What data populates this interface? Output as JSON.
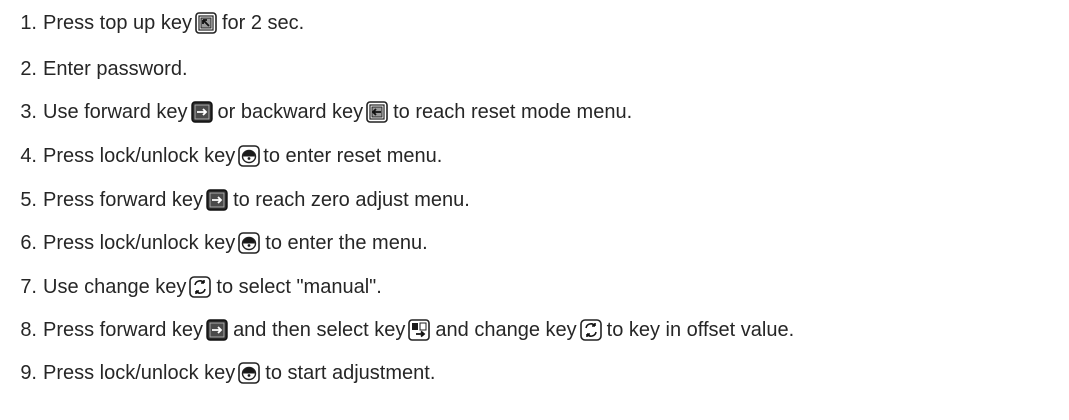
{
  "steps": [
    {
      "number": "1.",
      "parts": [
        {
          "type": "text",
          "value": "Press top up key"
        },
        {
          "type": "icon",
          "icon": "top-up-key-icon"
        },
        {
          "type": "text",
          "value": "for 2 sec."
        }
      ]
    },
    {
      "number": "2.",
      "parts": [
        {
          "type": "text",
          "value": "Enter password."
        }
      ]
    },
    {
      "number": "3.",
      "parts": [
        {
          "type": "text",
          "value": "Use forward key"
        },
        {
          "type": "icon",
          "icon": "forward-key-icon"
        },
        {
          "type": "text",
          "value": "or backward key"
        },
        {
          "type": "icon",
          "icon": "backward-key-icon"
        },
        {
          "type": "text",
          "value": "to reach reset mode menu."
        }
      ]
    },
    {
      "number": "4.",
      "parts": [
        {
          "type": "text",
          "value": "Press lock/unlock key"
        },
        {
          "type": "icon",
          "icon": "lock-unlock-key-icon"
        },
        {
          "type": "text",
          "value": "to enter reset menu.",
          "tight": true
        }
      ]
    },
    {
      "number": "5.",
      "parts": [
        {
          "type": "text",
          "value": "Press forward key"
        },
        {
          "type": "icon",
          "icon": "forward-key-icon"
        },
        {
          "type": "text",
          "value": "to reach zero adjust menu."
        }
      ]
    },
    {
      "number": "6.",
      "parts": [
        {
          "type": "text",
          "value": "Press lock/unlock key"
        },
        {
          "type": "icon",
          "icon": "lock-unlock-key-icon"
        },
        {
          "type": "text",
          "value": "to enter the menu."
        }
      ]
    },
    {
      "number": "7.",
      "parts": [
        {
          "type": "text",
          "value": "Use change key"
        },
        {
          "type": "icon",
          "icon": "change-key-icon"
        },
        {
          "type": "text",
          "value": "to select \"manual\"."
        }
      ]
    },
    {
      "number": "8.",
      "parts": [
        {
          "type": "text",
          "value": "Press forward key"
        },
        {
          "type": "icon",
          "icon": "forward-key-icon"
        },
        {
          "type": "text",
          "value": "and then select key"
        },
        {
          "type": "icon",
          "icon": "select-key-icon"
        },
        {
          "type": "text",
          "value": "and change key"
        },
        {
          "type": "icon",
          "icon": "change-key-icon"
        },
        {
          "type": "text",
          "value": "to key in offset value."
        }
      ]
    },
    {
      "number": "9.",
      "parts": [
        {
          "type": "text",
          "value": "Press lock/unlock key"
        },
        {
          "type": "icon",
          "icon": "lock-unlock-key-icon"
        },
        {
          "type": "text",
          "value": "to start adjustment."
        }
      ]
    }
  ]
}
